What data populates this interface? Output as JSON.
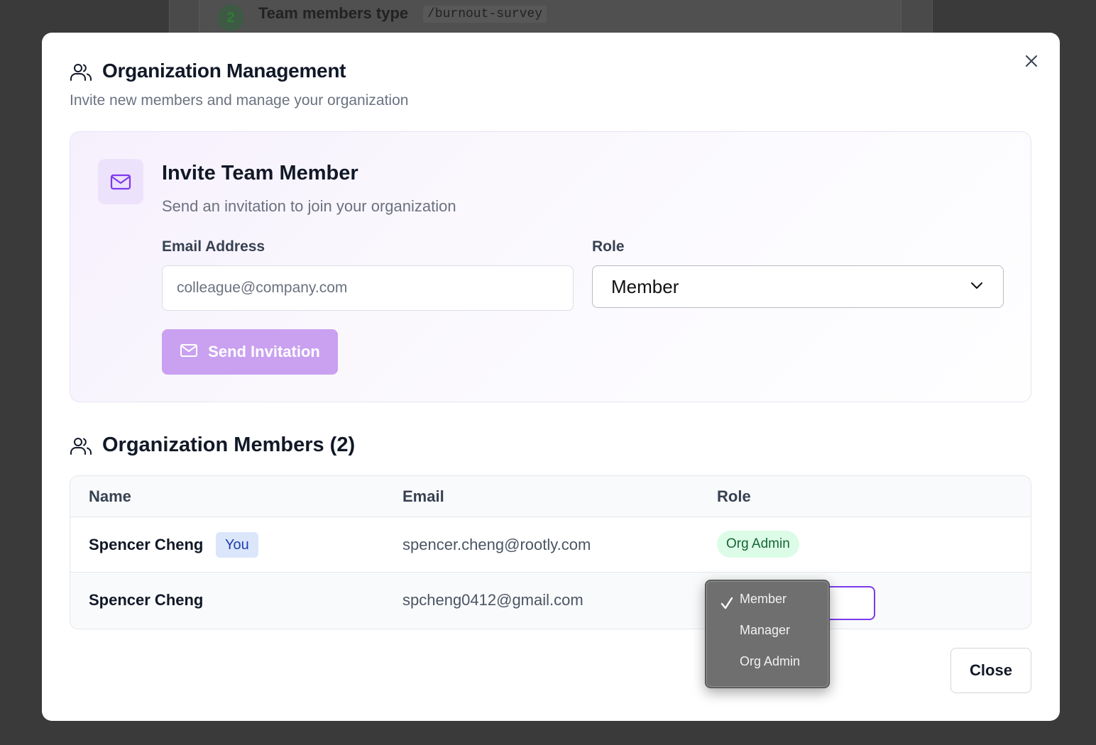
{
  "background": {
    "step_number": "2",
    "step_text": "Team members type",
    "command": "/burnout-survey"
  },
  "modal": {
    "title": "Organization Management",
    "subtitle": "Invite new members and manage your organization",
    "icons": {
      "header": "users-icon",
      "close": "close-icon"
    }
  },
  "invite": {
    "title": "Invite Team Member",
    "subtitle": "Send an invitation to join your organization",
    "email_label": "Email Address",
    "email_placeholder": "colleague@company.com",
    "email_value": "",
    "role_label": "Role",
    "role_value": "Member",
    "send_button": "Send Invitation",
    "icons": {
      "tile": "mail-icon",
      "button": "mail-icon",
      "select": "chevron-down-icon"
    }
  },
  "members": {
    "title": "Organization Members (2)",
    "columns": [
      "Name",
      "Email",
      "Role"
    ],
    "rows": [
      {
        "name": "Spencer Cheng",
        "badge": "You",
        "email": "spencer.cheng@rootly.com",
        "role": "Org Admin"
      },
      {
        "name": "Spencer Cheng",
        "badge": "",
        "email": "spcheng0412@gmail.com",
        "role": "Member"
      }
    ]
  },
  "role_dropdown": {
    "options": [
      "Member",
      "Manager",
      "Org Admin"
    ],
    "selected": "Member"
  },
  "footer": {
    "close_button": "Close"
  },
  "colors": {
    "accent": "#7c3aed",
    "send_button_bg": "#c9a1f0",
    "you_badge_bg": "#dbe6fb",
    "you_badge_text": "#1e40af",
    "org_admin_bg": "#dcfce7",
    "org_admin_text": "#166534"
  }
}
